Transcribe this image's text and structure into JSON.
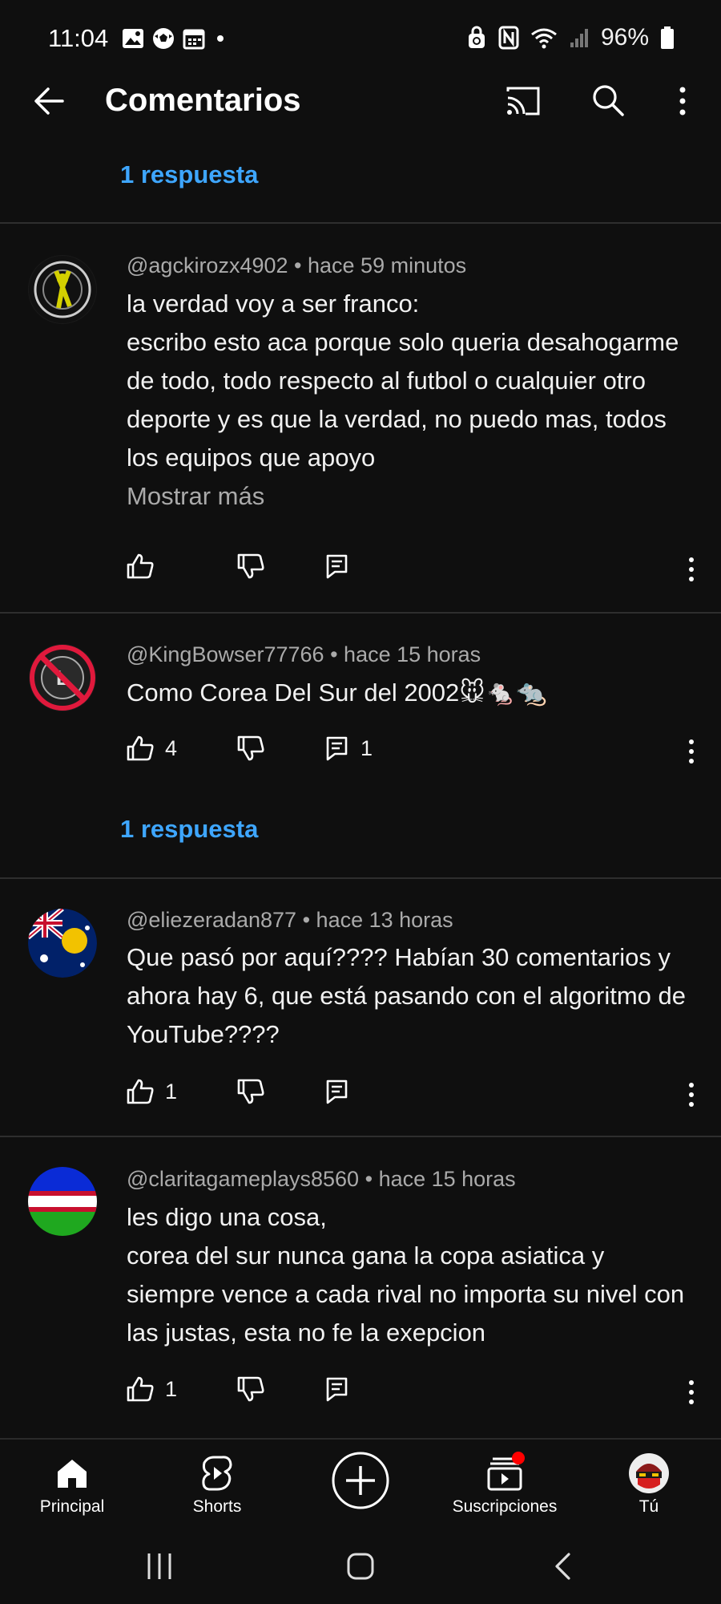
{
  "status_bar": {
    "time": "11:04",
    "battery": "96%",
    "notification_icons": [
      "gallery-icon",
      "soccer-ball-icon",
      "calendar-icon",
      "dot-icon"
    ],
    "system_icons": [
      "lock-rotate-icon",
      "nfc-icon",
      "wifi-icon",
      "signal-icon",
      "battery-icon"
    ]
  },
  "header": {
    "title": "Comentarios",
    "icons": [
      "back-arrow-icon",
      "cast-icon",
      "search-icon",
      "more-vert-icon"
    ]
  },
  "reply_links": [
    "1 respuesta",
    "1 respuesta"
  ],
  "comments": [
    {
      "handle": "@agckirozx4902",
      "time": "hace 59 minutos",
      "text": "la verdad voy a ser franco:\nescribo esto aca porque solo queria desahogarme de todo, todo respecto al futbol o cualquier otro deporte y es que la verdad, no puedo mas, todos los equipos que apoyo",
      "more": "Mostrar más",
      "likes": "",
      "replies": ""
    },
    {
      "handle": "@KingBowser77766",
      "time": "hace 15 horas",
      "text": "Como Corea Del Sur del 2002🐭🐁🐀",
      "likes": "4",
      "replies": "1"
    },
    {
      "handle": "@eliezeradan877",
      "time": "hace 13 horas",
      "text": "Que pasó por aquí???? Habían 30 comentarios y ahora hay 6, que está pasando con el algoritmo de YouTube????",
      "likes": "1",
      "replies": ""
    },
    {
      "handle": "@claritagameplays8560",
      "time": "hace 15 horas",
      "text": "les digo una cosa,\ncorea del sur nunca gana la copa asiatica y siempre vence a cada rival no importa su nivel con las justas, esta no fe la exepcion",
      "likes": "1",
      "replies": ""
    }
  ],
  "separator": "•",
  "bottom_nav": [
    {
      "label": "Principal",
      "icon": "home-icon"
    },
    {
      "label": "Shorts",
      "icon": "shorts-icon"
    },
    {
      "label": "",
      "icon": "create-plus-icon"
    },
    {
      "label": "Suscripciones",
      "icon": "subscriptions-icon"
    },
    {
      "label": "Tú",
      "icon": "profile-avatar-icon"
    }
  ],
  "colors": {
    "background": "#0f0f0f",
    "link": "#3ea6ff",
    "muted": "#aaaaaa",
    "badge": "#ff0000"
  }
}
